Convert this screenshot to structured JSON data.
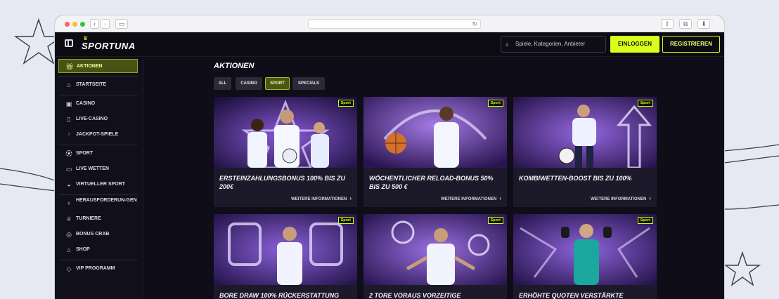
{
  "brand": {
    "logo_text": "SPORTUNA",
    "accent": "#d9ff1a"
  },
  "header": {
    "search_placeholder": "Spiele, Kategorien, Anbieter",
    "login_label": "EINLOGGEN",
    "register_label": "REGISTRIEREN"
  },
  "sidebar": {
    "items": [
      {
        "label": "AKTIONEN",
        "icon": "gift-icon",
        "active": true
      },
      {
        "label": "STARTSEITE",
        "icon": "home-icon"
      },
      {
        "label": "CASINO",
        "icon": "slot-machine-icon"
      },
      {
        "label": "LIVE-CASINO",
        "icon": "live-card-icon"
      },
      {
        "label": "JACKPOT-SPIELE",
        "icon": "jackpot-icon"
      },
      {
        "label": "SPORT",
        "icon": "football-icon"
      },
      {
        "label": "LIVE WETTEN",
        "icon": "live-camera-icon"
      },
      {
        "label": "VIRTUELLER SPORT",
        "icon": "gamepad-icon"
      },
      {
        "label": "HERAUSFORDERUN-GEN",
        "icon": "medal-icon"
      },
      {
        "label": "TURNIERE",
        "icon": "trophy-icon"
      },
      {
        "label": "BONUS CRAB",
        "icon": "crab-icon"
      },
      {
        "label": "SHOP",
        "icon": "shop-icon"
      },
      {
        "label": "VIP PROGRAMM",
        "icon": "diamond-icon"
      }
    ]
  },
  "main": {
    "title": "AKTIONEN",
    "tabs": [
      {
        "label": "ALL"
      },
      {
        "label": "CASINO"
      },
      {
        "label": "SPORT",
        "active": true
      },
      {
        "label": "SPECIALS"
      }
    ],
    "cards": [
      {
        "badge": "Sport",
        "title": "ERSTEINZAHLUNGSBONUS 100% BIS ZU 200€",
        "more": "WEITERE INFORMATIONEN"
      },
      {
        "badge": "Sport",
        "title": "WÖCHENTLICHER RELOAD-BONUS 50% BIS ZU 500 €",
        "more": "WEITERE INFORMATIONEN"
      },
      {
        "badge": "Sport",
        "title": "KOMBIWETTEN-BOOST BIS ZU 100%",
        "more": "WEITERE INFORMATIONEN"
      },
      {
        "badge": "Sport",
        "title": "BORE DRAW 100% RÜCKERSTATTUNG",
        "more": ""
      },
      {
        "badge": "Sport",
        "title": "2 TORE VORAUS VORZEITIGE",
        "more": ""
      },
      {
        "badge": "Sport",
        "title": "ERHÖHTE QUOTEN VERSTÄRKTE",
        "more": ""
      }
    ]
  }
}
